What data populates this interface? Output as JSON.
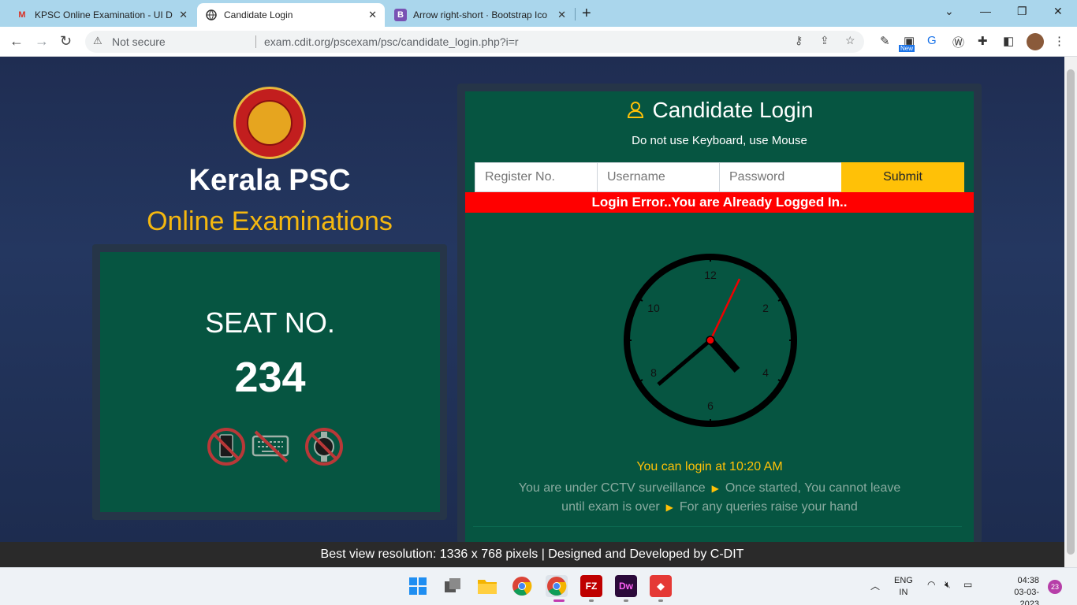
{
  "browser": {
    "tabs": [
      {
        "title": "KPSC Online Examination - UI De",
        "favicon": "gmail-icon"
      },
      {
        "title": "Candidate Login",
        "favicon": "globe-icon"
      },
      {
        "title": "Arrow right-short · Bootstrap Icon",
        "favicon": "bootstrap-icon"
      }
    ],
    "security_label": "Not secure",
    "url": "exam.cdit.org/pscexam/psc/candidate_login.php?i=r",
    "ext_new_badge": "New"
  },
  "brand": {
    "title": "Kerala PSC",
    "subtitle": "Online Examinations",
    "accent_color": "#f5b80f"
  },
  "seat": {
    "label": "SEAT NO.",
    "number": "234",
    "rules": [
      "no-mobile-icon",
      "no-keyboard-icon",
      "no-watch-icon"
    ]
  },
  "login": {
    "heading": "Candidate Login",
    "hint": "Do not use Keyboard, use Mouse",
    "register_placeholder": "Register No.",
    "username_placeholder": "Username",
    "password_placeholder": "Password",
    "submit_label": "Submit",
    "error": "Login Error..You are Already Logged In..",
    "clock_numbers": [
      "12",
      "2",
      "4",
      "6",
      "8",
      "10"
    ],
    "login_time": "You can login at 10:20 AM",
    "notice_1": "You are under CCTV surveillance",
    "notice_2": "Once started, You cannot leave",
    "notice_3": "until exam is over",
    "notice_4": "For any queries raise your hand"
  },
  "footer": {
    "text": "Best view resolution: 1336 x 768 pixels | Designed and Developed by C-DIT"
  },
  "taskbar": {
    "lang_1": "ENG",
    "lang_2": "IN",
    "time": "04:38",
    "date": "03-03-2023",
    "notifications": "23",
    "apps": [
      "FZ",
      "Dw"
    ]
  }
}
